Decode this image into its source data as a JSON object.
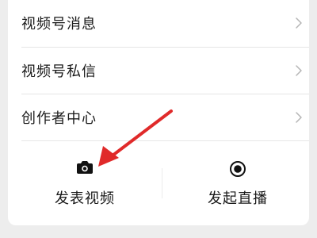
{
  "menu": {
    "items": [
      {
        "label": "视频号消息"
      },
      {
        "label": "视频号私信"
      },
      {
        "label": "创作者中心"
      }
    ]
  },
  "actions": {
    "publish_video": {
      "label": "发表视频",
      "icon": "camera-icon"
    },
    "start_live": {
      "label": "发起直播",
      "icon": "live-record-icon"
    }
  },
  "annotation": {
    "color": "#e02a2a",
    "icon": "red-arrow"
  }
}
